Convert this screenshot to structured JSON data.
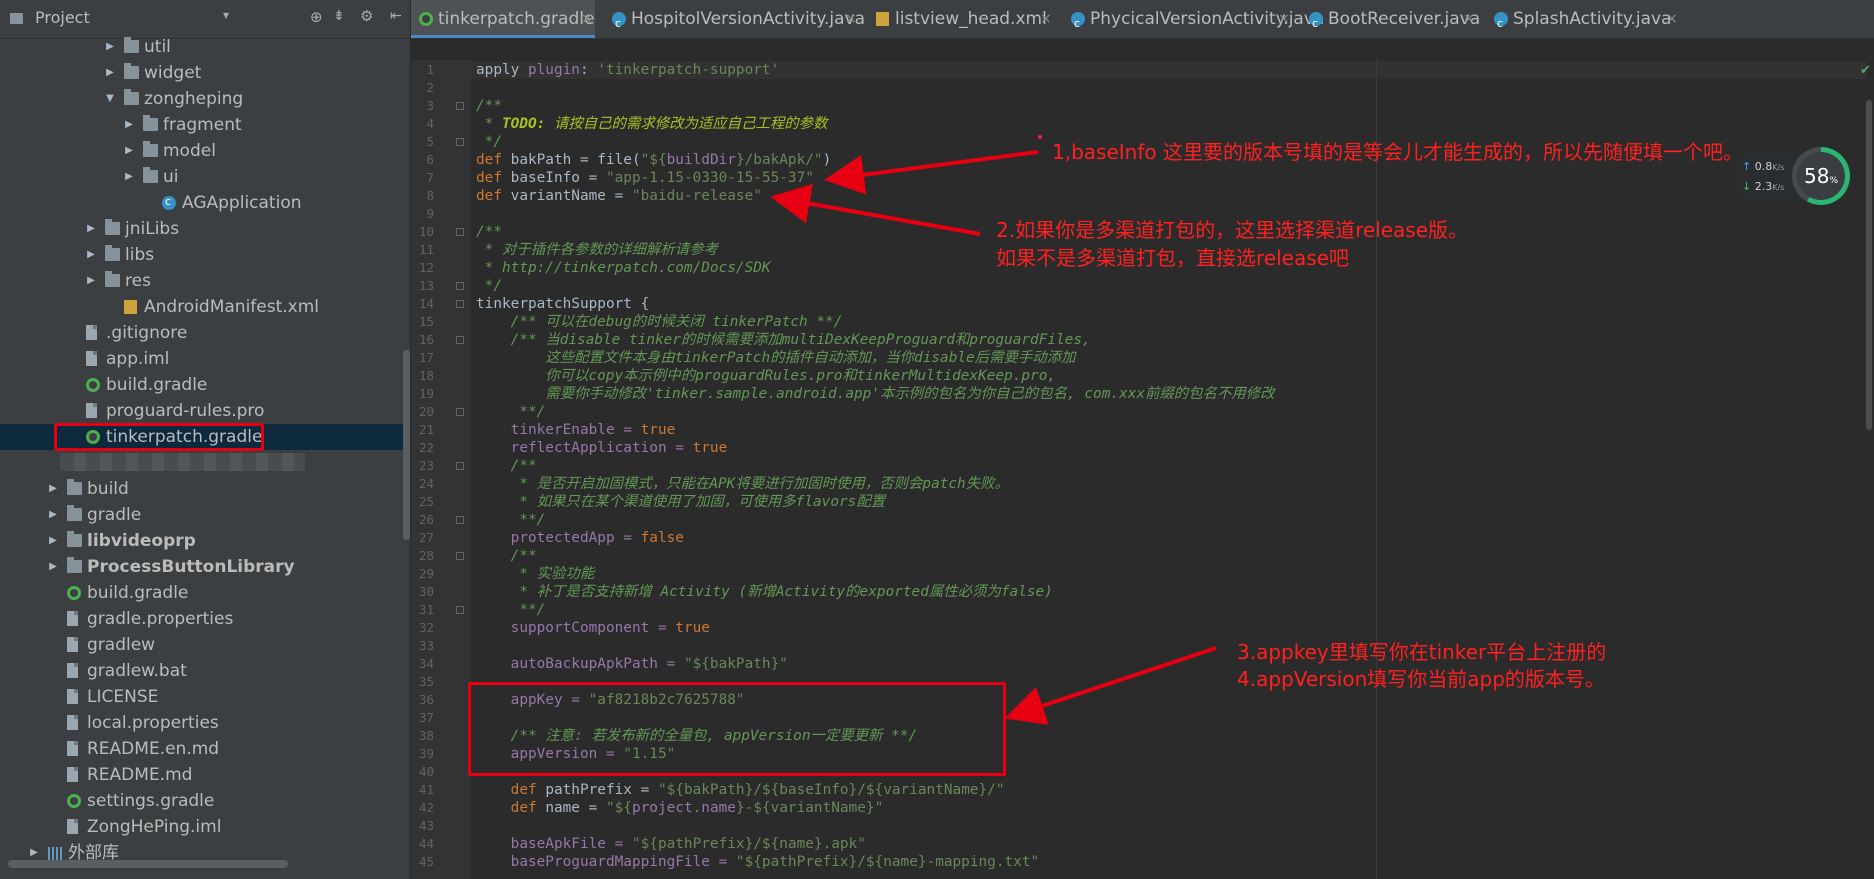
{
  "project_panel": {
    "title": "Project",
    "tree": [
      {
        "label": "util",
        "depth": 4,
        "icon": "folder",
        "arrow": "right"
      },
      {
        "label": "widget",
        "depth": 4,
        "icon": "folder",
        "arrow": "right"
      },
      {
        "label": "zongheping",
        "depth": 4,
        "icon": "folder",
        "arrow": "down"
      },
      {
        "label": "fragment",
        "depth": 5,
        "icon": "folder",
        "arrow": "right"
      },
      {
        "label": "model",
        "depth": 5,
        "icon": "folder",
        "arrow": "right"
      },
      {
        "label": "ui",
        "depth": 5,
        "icon": "folder",
        "arrow": "right"
      },
      {
        "label": "AGApplication",
        "depth": 6,
        "icon": "java",
        "arrow": ""
      },
      {
        "label": "jniLibs",
        "depth": 3,
        "icon": "folder",
        "arrow": "right"
      },
      {
        "label": "libs",
        "depth": 3,
        "icon": "folder",
        "arrow": "right"
      },
      {
        "label": "res",
        "depth": 3,
        "icon": "folder",
        "arrow": "right"
      },
      {
        "label": "AndroidManifest.xml",
        "depth": 4,
        "icon": "xml",
        "arrow": ""
      },
      {
        "label": ".gitignore",
        "depth": 2,
        "icon": "file",
        "arrow": ""
      },
      {
        "label": "app.iml",
        "depth": 2,
        "icon": "file",
        "arrow": ""
      },
      {
        "label": "build.gradle",
        "depth": 2,
        "icon": "gradle",
        "arrow": ""
      },
      {
        "label": "proguard-rules.pro",
        "depth": 2,
        "icon": "file",
        "arrow": ""
      },
      {
        "label": "tinkerpatch.gradle",
        "depth": 2,
        "icon": "gradle",
        "arrow": "",
        "selected": true
      },
      {
        "label": "",
        "depth": 2,
        "icon": "",
        "arrow": ""
      },
      {
        "label": "build",
        "depth": 1,
        "icon": "folder",
        "arrow": "right"
      },
      {
        "label": "gradle",
        "depth": 1,
        "icon": "folder",
        "arrow": "right"
      },
      {
        "label": "libvideoprp",
        "depth": 1,
        "icon": "folder",
        "arrow": "right",
        "bold": true
      },
      {
        "label": "ProcessButtonLibrary",
        "depth": 1,
        "icon": "folder",
        "arrow": "right",
        "bold": true
      },
      {
        "label": "build.gradle",
        "depth": 1,
        "icon": "gradle",
        "arrow": ""
      },
      {
        "label": "gradle.properties",
        "depth": 1,
        "icon": "file",
        "arrow": ""
      },
      {
        "label": "gradlew",
        "depth": 1,
        "icon": "file",
        "arrow": ""
      },
      {
        "label": "gradlew.bat",
        "depth": 1,
        "icon": "file",
        "arrow": ""
      },
      {
        "label": "LICENSE",
        "depth": 1,
        "icon": "file",
        "arrow": ""
      },
      {
        "label": "local.properties",
        "depth": 1,
        "icon": "file",
        "arrow": ""
      },
      {
        "label": "README.en.md",
        "depth": 1,
        "icon": "file",
        "arrow": ""
      },
      {
        "label": "README.md",
        "depth": 1,
        "icon": "file",
        "arrow": ""
      },
      {
        "label": "settings.gradle",
        "depth": 1,
        "icon": "gradle",
        "arrow": ""
      },
      {
        "label": "ZongHePing.iml",
        "depth": 1,
        "icon": "file",
        "arrow": ""
      },
      {
        "label": "外部库",
        "depth": 0,
        "icon": "lib",
        "arrow": "right"
      }
    ]
  },
  "tabs": [
    {
      "label": "tinkerpatch.gradle",
      "icon": "gradle",
      "active": true
    },
    {
      "label": "HospitolVersionActivity.java",
      "icon": "java",
      "active": false
    },
    {
      "label": "listview_head.xml",
      "icon": "xml",
      "active": false
    },
    {
      "label": "PhycicalVersionActivity.java",
      "icon": "java",
      "active": false
    },
    {
      "label": "BootReceiver.java",
      "icon": "java",
      "active": false
    },
    {
      "label": "SplashActivity.java",
      "icon": "java",
      "active": false
    }
  ],
  "tab_close": "×",
  "code": {
    "l1a": "apply ",
    "l1b": "plugin",
    "l1c": ": ",
    "l1d": "'tinkerpatch-support'",
    "l3": "/**",
    "l4a": " * ",
    "l4b": "TODO:",
    "l4c": " 请按自己的需求修改为适应自己工程的参数",
    "l5": " */",
    "l6a": "def ",
    "l6b": "bakPath = file(",
    "l6c": "\"${",
    "l6d": "buildDir",
    "l6e": "}/bakApk/\"",
    "l6f": ")",
    "l7a": "def ",
    "l7b": "baseInfo = ",
    "l7c": "\"app-1.15-0330-15-55-37\"",
    "l8a": "def ",
    "l8b": "variantName = ",
    "l8c": "\"baidu-release\"",
    "l10": "/**",
    "l11": " * 对于插件各参数的详细解析请参考",
    "l12": " * http://tinkerpatch.com/Docs/SDK",
    "l13": " */",
    "l14": "tinkerpatchSupport {",
    "l15": "    /** 可以在debug的时候关闭 tinkerPatch **/",
    "l16": "    /** 当disable tinker的时候需要添加multiDexKeepProguard和proguardFiles,",
    "l17": "        这些配置文件本身由tinkerPatch的插件自动添加，当你disable后需要手动添加",
    "l18": "        你可以copy本示例中的proguardRules.pro和tinkerMultidexKeep.pro,",
    "l19": "        需要你手动修改'tinker.sample.android.app'本示例的包名为你自己的包名, com.xxx前缀的包名不用修改",
    "l20": "     **/",
    "l21a": "    tinkerEnable = ",
    "l21b": "true",
    "l22a": "    reflectApplication = ",
    "l22b": "true",
    "l23": "    /**",
    "l24": "     * 是否开启加固模式，只能在APK将要进行加固时使用，否则会patch失败。",
    "l25": "     * 如果只在某个渠道使用了加固，可使用多flavors配置",
    "l26": "     **/",
    "l27a": "    protectedApp = ",
    "l27b": "false",
    "l28": "    /**",
    "l29": "     * 实验功能",
    "l30": "     * 补丁是否支持新增 Activity (新增Activity的exported属性必须为false)",
    "l31": "     **/",
    "l32a": "    supportComponent = ",
    "l32b": "true",
    "l34a": "    autoBackupApkPath = ",
    "l34b": "\"${bakPath}\"",
    "l36a": "    appKey = ",
    "l36b": "\"af8218b2c7625788\"",
    "l38": "    /** 注意: 若发布新的全量包, appVersion一定要更新 **/",
    "l39a": "    appVersion = ",
    "l39b": "\"1.15\"",
    "l41a": "    def ",
    "l41b": "pathPrefix = ",
    "l41c": "\"${bakPath}/${baseInfo}/${variantName}/\"",
    "l42a": "    def ",
    "l42b": "name = ",
    "l42c": "\"${",
    "l42d": "project",
    "l42e": ".",
    "l42f": "name",
    "l42g": "}-${variantName}\"",
    "l44a": "    baseApkFile = ",
    "l44b": "\"${pathPrefix}/${name}",
    "l44c": ".apk\"",
    "l45a": "    baseProguardMappingFile = ",
    "l45b": "\"${pathPrefix}/${name}",
    "l45c": "-mapping.txt\""
  },
  "line_numbers": [
    "1",
    "2",
    "3",
    "4",
    "5",
    "6",
    "7",
    "8",
    "9",
    "10",
    "11",
    "12",
    "13",
    "14",
    "15",
    "16",
    "17",
    "18",
    "19",
    "20",
    "21",
    "22",
    "23",
    "24",
    "25",
    "26",
    "27",
    "28",
    "29",
    "30",
    "31",
    "32",
    "33",
    "34",
    "35",
    "36",
    "37",
    "38",
    "39",
    "40",
    "41",
    "42",
    "43",
    "44",
    "45"
  ],
  "annotations": {
    "a1": "1,baseInfo 这里要的版本号填的是等会儿才能生成的，所以先随便填一个吧。",
    "a2_line1": "2.如果你是多渠道打包的，这里选择渠道release版。",
    "a2_line2": "如果不是多渠道打包，直接选release吧",
    "a3_line1": "3.appkey里填写你在tinker平台上注册的",
    "a3_line2": "4.appVersion填写你当前app的版本号。"
  },
  "net_widget": {
    "upload": "0.8",
    "upload_unit": "K/s",
    "download": "2.3",
    "download_unit": "K/s",
    "cpu_percent": "58",
    "cpu_suffix": "%"
  },
  "colors": {
    "accent": "#4a88c7",
    "annotation": "#ff2020",
    "highlight_box": "#e60012"
  }
}
